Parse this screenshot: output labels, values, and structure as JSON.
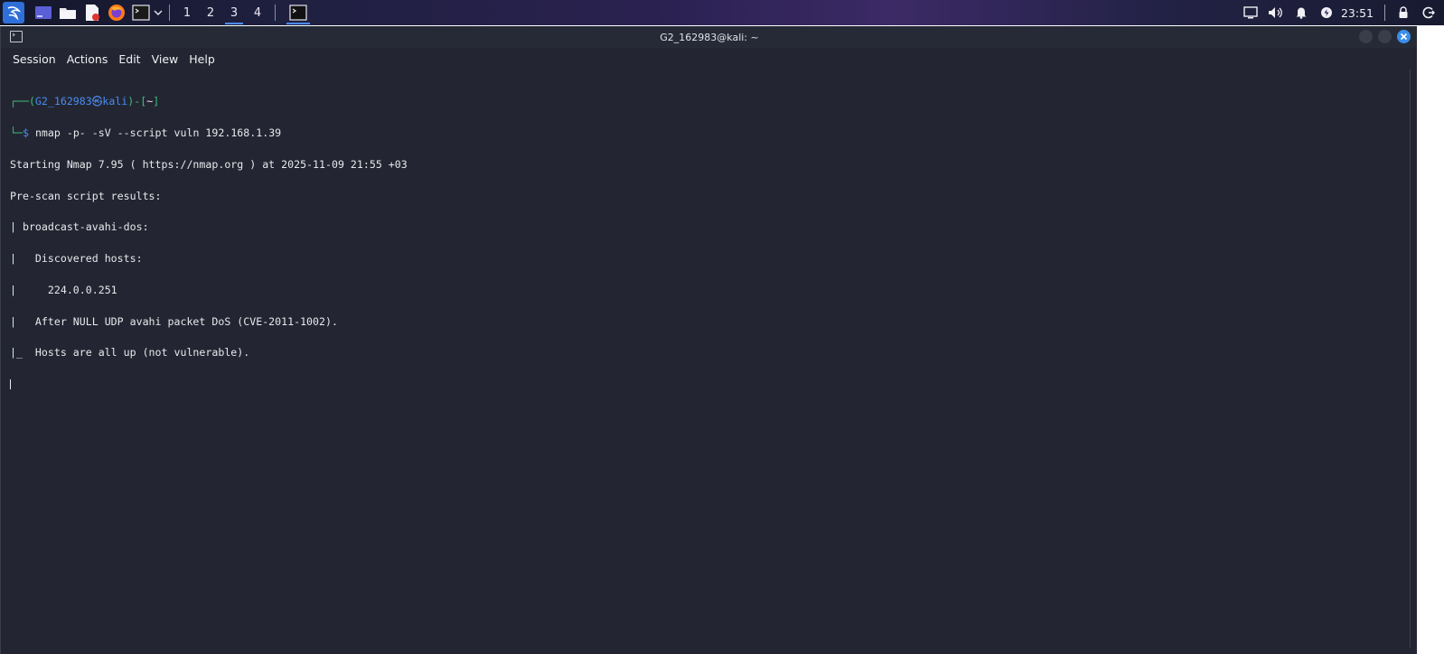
{
  "panel": {
    "workspaces": [
      "1",
      "2",
      "3",
      "4"
    ],
    "active_workspace": "3",
    "clock": "23:51"
  },
  "window": {
    "title": "G2_162983@kali: ~"
  },
  "menu": {
    "items": [
      "Session",
      "Actions",
      "Edit",
      "View",
      "Help"
    ]
  },
  "terminal": {
    "prompt_user": "G2_162983",
    "prompt_at": "㉿",
    "prompt_host": "kali",
    "prompt_dir": "~",
    "command": "nmap -p- -sV --script vuln 192.168.1.39",
    "output": [
      "Starting Nmap 7.95 ( https://nmap.org ) at 2025-11-09 21:55 +03",
      "Pre-scan script results:",
      "| broadcast-avahi-dos:",
      "|   Discovered hosts:",
      "|     224.0.0.251",
      "|   After NULL UDP avahi packet DoS (CVE-2011-1002).",
      "|_  Hosts are all up (not vulnerable)."
    ]
  },
  "colors": {
    "terminal_bg": "#232632",
    "prompt_blue": "#4a8cf0",
    "accent": "#3b8eea"
  }
}
